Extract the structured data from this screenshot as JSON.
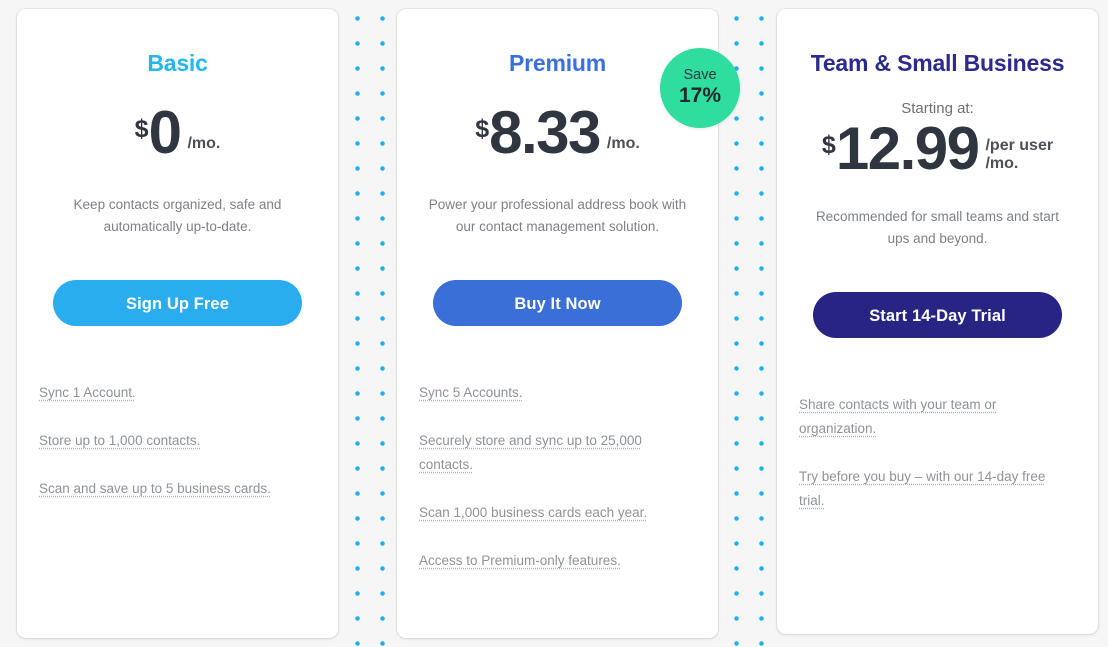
{
  "decor": {
    "dot_color": "#1eb0f0",
    "dot_grid_spacing_px": 25
  },
  "page_background": "#f6f6f7",
  "plans": [
    {
      "id": "basic",
      "title": "Basic",
      "title_color": "#22b7f2",
      "starting_at": "",
      "currency": "$",
      "amount": "0",
      "per": "/mo.",
      "description": "Keep contacts organized, safe and automatically up-to-date.",
      "cta_label": "Sign Up Free",
      "cta_color": "#29adef",
      "features": [
        "Sync 1 Account.",
        "Store up to 1,000 contacts.",
        "Scan and save up to 5 business cards."
      ]
    },
    {
      "id": "premium",
      "title": "Premium",
      "title_color": "#3a6fe0",
      "starting_at": "",
      "currency": "$",
      "amount": "8.33",
      "per": "/mo.",
      "description": "Power your professional address book with our contact management solution.",
      "cta_label": "Buy It Now",
      "cta_color": "#3a6fd8",
      "badge": {
        "label": "Save",
        "value": "17%",
        "color": "#2fdd9e"
      },
      "features": [
        "Sync 5 Accounts.",
        "Securely store and sync up to 25,000 contacts.",
        "Scan 1,000 business cards each year.",
        "Access to Premium-only features."
      ]
    },
    {
      "id": "team",
      "title": "Team & Small Business",
      "title_color": "#2b2b8f",
      "starting_at": "Starting at:",
      "currency": "$",
      "amount": "12.99",
      "per": "/per user\n/mo.",
      "description": "Recommended for small teams and start ups and beyond.",
      "cta_label": "Start 14-Day Trial",
      "cta_color": "#272483",
      "features": [
        "Share contacts with your team or organization.",
        "Try before you buy – with our 14-day free trial."
      ]
    }
  ]
}
